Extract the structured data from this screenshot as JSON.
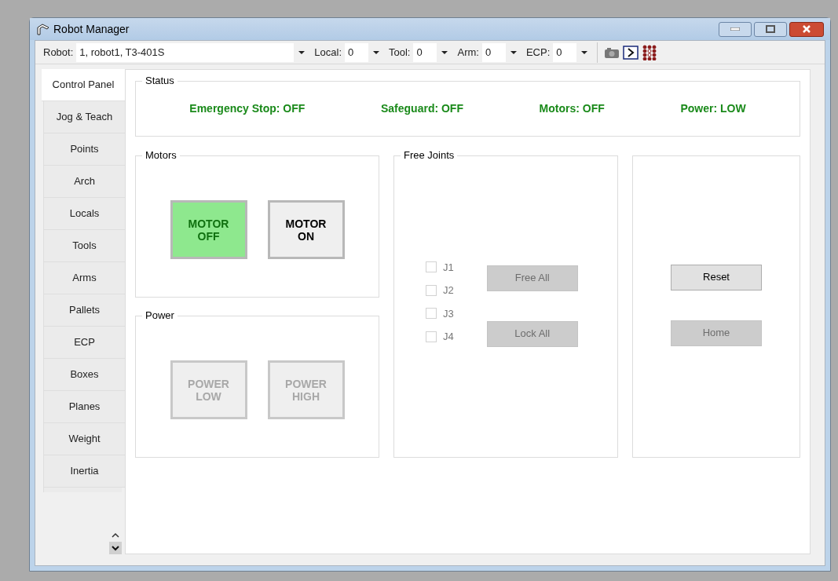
{
  "window": {
    "title": "Robot Manager"
  },
  "toolbar": {
    "selectors": [
      {
        "label": "Robot:",
        "value": "1, robot1, T3-401S",
        "kind": "wide"
      },
      {
        "label": "Local:",
        "value": "0",
        "kind": "narrow"
      },
      {
        "label": "Tool:",
        "value": "0",
        "kind": "narrow"
      },
      {
        "label": "Arm:",
        "value": "0",
        "kind": "narrow"
      },
      {
        "label": "ECP:",
        "value": "0",
        "kind": "narrow"
      }
    ]
  },
  "tabs": [
    {
      "label": "Control Panel",
      "selected": true
    },
    {
      "label": "Jog & Teach",
      "selected": false
    },
    {
      "label": "Points",
      "selected": false
    },
    {
      "label": "Arch",
      "selected": false
    },
    {
      "label": "Locals",
      "selected": false
    },
    {
      "label": "Tools",
      "selected": false
    },
    {
      "label": "Arms",
      "selected": false
    },
    {
      "label": "Pallets",
      "selected": false
    },
    {
      "label": "ECP",
      "selected": false
    },
    {
      "label": "Boxes",
      "selected": false
    },
    {
      "label": "Planes",
      "selected": false
    },
    {
      "label": "Weight",
      "selected": false
    },
    {
      "label": "Inertia",
      "selected": false
    }
  ],
  "status": {
    "title": "Status",
    "items": [
      "Emergency Stop: OFF",
      "Safeguard: OFF",
      "Motors: OFF",
      "Power: LOW"
    ]
  },
  "motors": {
    "title": "Motors",
    "buttons": [
      {
        "line1": "MOTOR",
        "line2": "OFF",
        "selected": true,
        "disabled": false
      },
      {
        "line1": "MOTOR",
        "line2": "ON",
        "selected": false,
        "disabled": false
      }
    ]
  },
  "power": {
    "title": "Power",
    "buttons": [
      {
        "line1": "POWER",
        "line2": "LOW",
        "selected": false,
        "disabled": true
      },
      {
        "line1": "POWER",
        "line2": "HIGH",
        "selected": false,
        "disabled": true
      }
    ]
  },
  "free_joints": {
    "title": "Free Joints",
    "joints": [
      {
        "label": "J1",
        "checked": false,
        "disabled": true
      },
      {
        "label": "J2",
        "checked": false,
        "disabled": true
      },
      {
        "label": "J3",
        "checked": false,
        "disabled": true
      },
      {
        "label": "J4",
        "checked": false,
        "disabled": true
      }
    ],
    "buttons": [
      {
        "label": "Free All",
        "disabled": true
      },
      {
        "label": "Lock All",
        "disabled": true
      }
    ]
  },
  "actions": {
    "buttons": [
      {
        "label": "Reset",
        "disabled": false
      },
      {
        "label": "Home",
        "disabled": true
      }
    ]
  }
}
